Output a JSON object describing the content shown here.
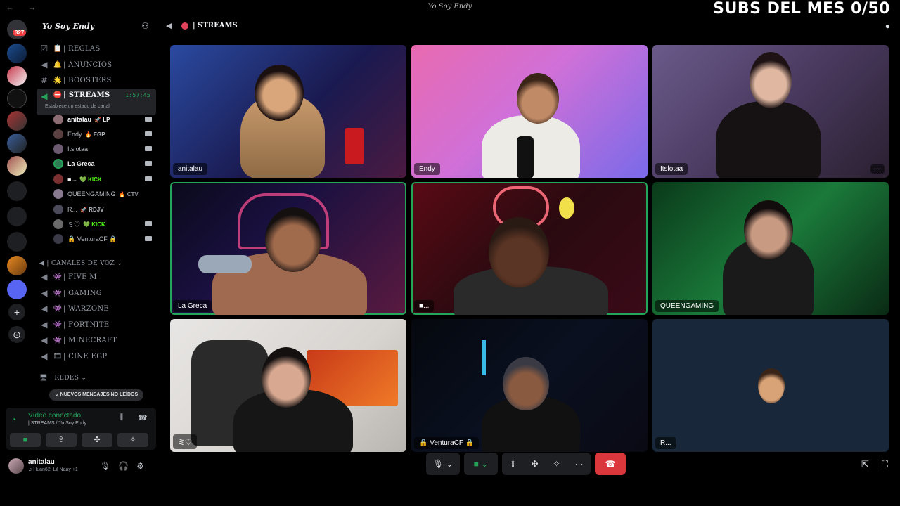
{
  "window": {
    "title": "Yo Soy Endy",
    "nav": "← →"
  },
  "overlay": {
    "subs_text": "SUBS DEL MES 0/50"
  },
  "rail": {
    "mentions_badge": "327"
  },
  "server": {
    "name": "Yo Soy Endy",
    "chevron": "⌄",
    "invite_icon": "person-add-icon"
  },
  "channels": [
    {
      "emoji": "📋",
      "label": "| REGLAS"
    },
    {
      "emoji": "🔔",
      "label": "| ANUNCIOS"
    },
    {
      "emoji": "🌟",
      "label": "| BOOSTERS"
    }
  ],
  "active_channel": {
    "label": "| STREAMS",
    "timer": "1:57:45",
    "status_hint": "Establece un estado de canal"
  },
  "voice_users": [
    {
      "name": "anitalau",
      "tag": "🚀 LP",
      "tag_color": "#f2f3f5",
      "avatar": "#8c6d74"
    },
    {
      "name": "Endy",
      "tag": "🔥 EGP",
      "tag_color": "#f2f3f5",
      "avatar": "#5a4040"
    },
    {
      "name": "Itslotaa",
      "tag": "",
      "tag_color": "#f2f3f5",
      "avatar": "#6b5a70"
    },
    {
      "name": "La Greca",
      "tag": "",
      "tag_color": "#f2f3f5",
      "avatar": "#2d7a55"
    },
    {
      "name": "■...",
      "tag": "💚 KICK",
      "tag_color": "#53fc18",
      "avatar": "#7a3030"
    },
    {
      "name": "QUEENGAMING",
      "tag": "🔥 CTV",
      "tag_color": "#949ba4",
      "avatar": "#8a7a90"
    },
    {
      "name": "R...",
      "tag": "🚀 RDJV",
      "tag_color": "#f2f3f5",
      "avatar": "#4a4a5a"
    },
    {
      "name": "ミ♡",
      "tag": "💚 KICK",
      "tag_color": "#53fc18",
      "avatar": "#6a6a6a"
    },
    {
      "name": "🔒 VenturaCF 🔒",
      "tag": "",
      "tag_color": "#f2f3f5",
      "avatar": "#3a3a48"
    }
  ],
  "voice_category": {
    "label": "| CANALES DE VOZ ⌄"
  },
  "voice_channels": [
    {
      "label": "| FIVE M"
    },
    {
      "label": "| GAMING"
    },
    {
      "label": "| WARZONE"
    },
    {
      "label": "| FORTNITE"
    },
    {
      "label": "| MINECRAFT"
    },
    {
      "label": "| CINE EGP"
    }
  ],
  "redes_category": {
    "label": "| REDES ⌄"
  },
  "unread_pill": "⌄ NUEVOS MENSAJES NO LEÍDOS",
  "voice_panel": {
    "status": "Vídeo conectado",
    "location": "| STREAMS / Yo Soy Endy"
  },
  "user": {
    "name": "anitalau",
    "activity": "♫ Huan62, Lil Naay +1"
  },
  "stage": {
    "channel_name": "| STREAMS"
  },
  "tiles": [
    {
      "label": "anitalau",
      "more": ""
    },
    {
      "label": "Endy",
      "more": ""
    },
    {
      "label": "Itslotaa",
      "more": "···"
    },
    {
      "label": "La Greca",
      "more": ""
    },
    {
      "label": "■...",
      "more": ""
    },
    {
      "label": "QUEENGAMING",
      "more": ""
    },
    {
      "label": "ミ♡",
      "more": ""
    },
    {
      "label": "🔒 VenturaCF 🔒",
      "more": ""
    },
    {
      "label": "R...",
      "more": ""
    }
  ],
  "controls": {
    "more": "···"
  },
  "colors": {
    "speaking": "#23a55a",
    "hangup": "#da373c",
    "accent_red": "#e0445b"
  }
}
